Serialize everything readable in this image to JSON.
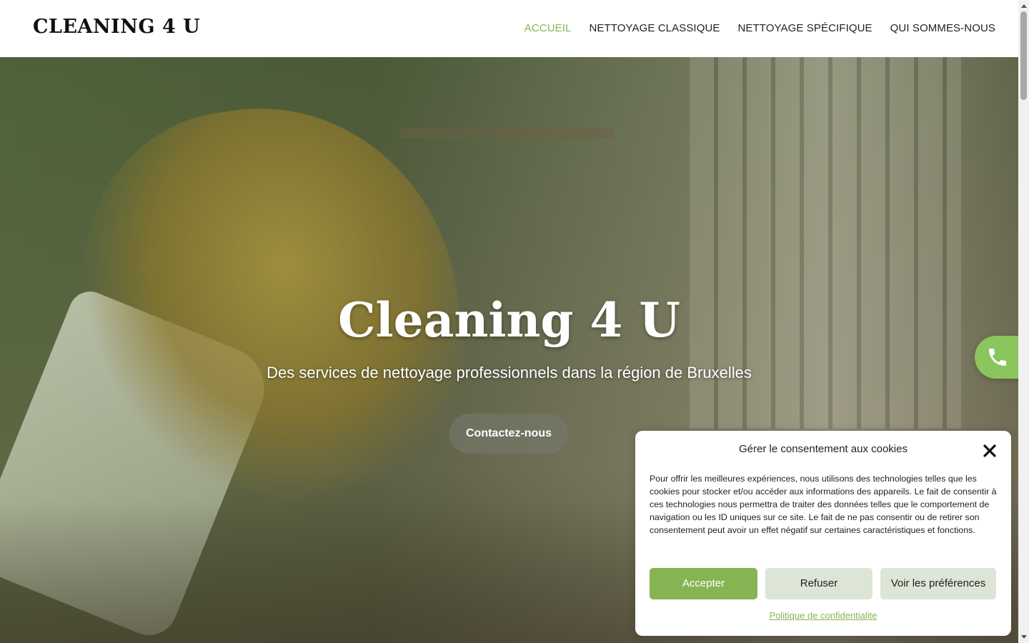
{
  "header": {
    "logo": "CLEANING 4 U",
    "nav": [
      {
        "label": "ACCUEIL"
      },
      {
        "label": "NETTOYAGE CLASSIQUE"
      },
      {
        "label": "NETTOYAGE SPÉCIFIQUE"
      },
      {
        "label": "QUI SOMMES-NOUS"
      }
    ]
  },
  "hero": {
    "title": "Cleaning 4 U",
    "subtitle": "Des services de nettoyage professionnels dans la région de Bruxelles",
    "cta_label": "Contactez-nous"
  },
  "phone_button": {
    "icon": "phone-icon"
  },
  "cookie": {
    "title": "Gérer le consentement aux cookies",
    "close_icon": "close-icon",
    "text": "Pour offrir les meilleures expériences, nous utilisons des technologies telles que les cookies pour stocker et/ou accéder aux informations des appareils. Le fait de consentir à ces technologies nous permettra de traiter des données telles que le comportement de navigation ou les ID uniques sur ce site. Le fait de ne pas consentir ou de retirer son consentement peut avoir un effet négatif sur certaines caractéristiques et fonctions.",
    "accept_label": "Accepter",
    "refuse_label": "Refuser",
    "prefs_label": "Voir les préférences",
    "policy_link": "Politique de confidentialite"
  },
  "colors": {
    "accent": "#86b453",
    "phone_button": "#8bc55d",
    "secondary_button": "#dde5d6"
  }
}
